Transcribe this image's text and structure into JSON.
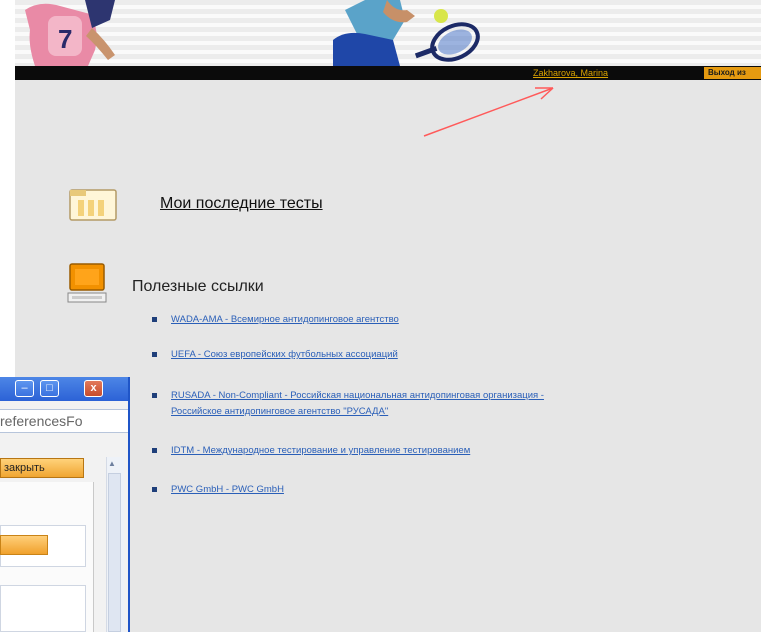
{
  "header": {
    "user_name": "Zakharova, Marina",
    "logout_label": "Выход из"
  },
  "main": {
    "my_tests_label": "Мои последние тесты",
    "useful_links_title": "Полезные ссылки",
    "links": [
      {
        "text": "WADA-AMA - Всемирное антидопинговое агентство"
      },
      {
        "text": "UEFA - Союз европейских футбольных ассоциаций"
      },
      {
        "text": "RUSADA - Non-Compliant - Российская национальная антидопинговая организация -",
        "text2": "Российское антидопинговое агентство \"РУСАДА\""
      },
      {
        "text": "IDTM - Международное тестирование и управление тестированием"
      },
      {
        "text": "PWC GmbH - PWC GmbH"
      }
    ]
  },
  "popup": {
    "address_text": "referencesFo",
    "close_action_label": "закрыть"
  },
  "colors": {
    "accent_orange": "#e59a10",
    "link_blue": "#2a5fb8",
    "title_bar_blue": "#2c62d6"
  }
}
